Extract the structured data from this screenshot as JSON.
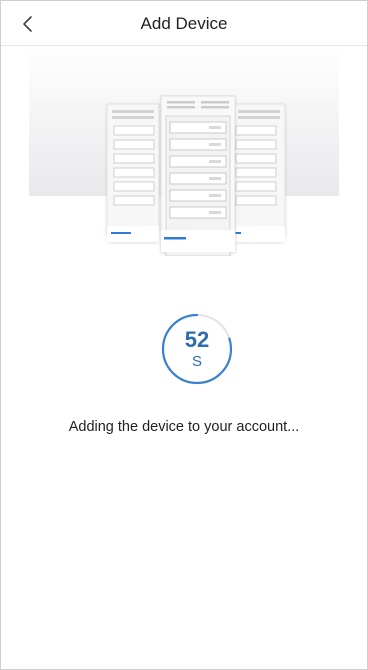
{
  "header": {
    "title": "Add Device",
    "back_icon": "chevron-left-icon"
  },
  "illustration": {
    "icon": "server-rack-illustration",
    "accent_color": "#2e7cd6"
  },
  "countdown": {
    "value": "52",
    "unit": "S",
    "progress": 0.8,
    "color": "#3a82cf",
    "track_color": "#e3e3e3"
  },
  "status": {
    "message": "Adding the device to your account..."
  }
}
